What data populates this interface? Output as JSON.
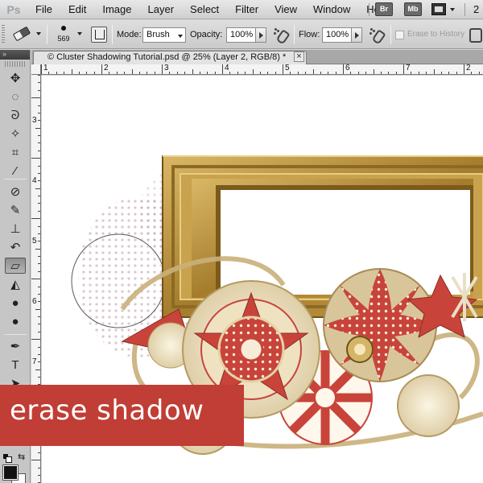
{
  "app": {
    "logo": "Ps",
    "menu": [
      "File",
      "Edit",
      "Image",
      "Layer",
      "Select",
      "Filter",
      "View",
      "Window",
      "Help"
    ],
    "bridge_badge": "Br",
    "minibridge_badge": "Mb",
    "zoom_display": "2"
  },
  "options": {
    "brush_size": "569",
    "mode_label": "Mode:",
    "mode_value": "Brush",
    "opacity_label": "Opacity:",
    "opacity_value": "100%",
    "flow_label": "Flow:",
    "flow_value": "100%",
    "erase_to_history": "Erase to History",
    "erase_to_history_checked": false
  },
  "document": {
    "tab_title": "© Cluster Shadowing Tutorial.psd @ 25% (Layer 2, RGB/8) *",
    "close_label": "×"
  },
  "rulers": {
    "horizontal": [
      "1",
      "2",
      "3",
      "4",
      "5",
      "6",
      "7",
      "2"
    ],
    "vertical": [
      "3",
      "4",
      "5",
      "6",
      "7"
    ]
  },
  "toolbox": {
    "active_tool": "eraser-tool",
    "foreground_color": "#111111",
    "background_color": "#ffffff",
    "tools": [
      {
        "name": "move-tool",
        "glyph": "✥"
      },
      {
        "name": "marquee-tool",
        "glyph": "◌"
      },
      {
        "name": "lasso-tool",
        "glyph": "ᘐ"
      },
      {
        "name": "quick-selection-tool",
        "glyph": "✧"
      },
      {
        "name": "crop-tool",
        "glyph": "⌗"
      },
      {
        "name": "eyedropper-tool",
        "glyph": "⁄"
      },
      {
        "name": "spot-healing-tool",
        "glyph": "⊘"
      },
      {
        "name": "brush-tool",
        "glyph": "✎"
      },
      {
        "name": "clone-stamp-tool",
        "glyph": "⊥"
      },
      {
        "name": "history-brush-tool",
        "glyph": "↶"
      },
      {
        "name": "eraser-tool",
        "glyph": "▱"
      },
      {
        "name": "paint-bucket-tool",
        "glyph": "◭"
      },
      {
        "name": "blur-tool",
        "glyph": "●"
      },
      {
        "name": "dodge-tool",
        "glyph": "●"
      },
      {
        "name": "pen-tool",
        "glyph": "✒"
      },
      {
        "name": "type-tool",
        "glyph": "T"
      },
      {
        "name": "path-selection-tool",
        "glyph": "➤"
      }
    ]
  },
  "caption": {
    "text": "erase shadow",
    "color": "#c03e35"
  },
  "colors": {
    "frame_gold": "#b8923e",
    "frame_dark": "#7a5c1e",
    "ribbon_red": "#c8443b",
    "cream": "#f1e7cc"
  }
}
